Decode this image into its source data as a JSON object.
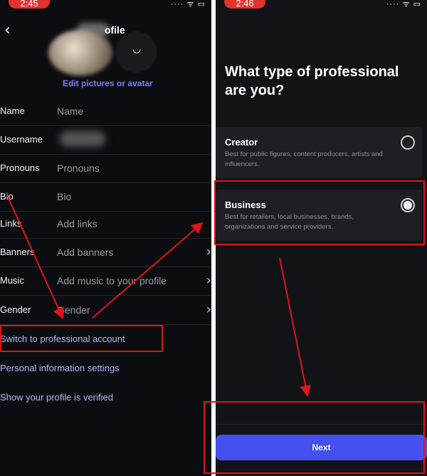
{
  "left_screen": {
    "status_time": "2:45",
    "status_icons": "···· ᯤ ▭",
    "back_icon": "chevron-left-icon",
    "title_partial": "ofile",
    "edit_link": "Edit pictures or avatar",
    "rows": [
      {
        "label": "Name",
        "value": "Name",
        "chevron": ""
      },
      {
        "label": "Username",
        "value": "",
        "chevron": ""
      },
      {
        "label": "Pronouns",
        "value": "Pronouns",
        "chevron": ""
      },
      {
        "label": "Bio",
        "value": "Bio",
        "chevron": ""
      },
      {
        "label": "Links",
        "value": "Add links",
        "chevron": ""
      },
      {
        "label": "Banners",
        "value": "Add banners",
        "chevron": "›"
      },
      {
        "label": "Music",
        "value": "Add music to your profile",
        "chevron": "›"
      },
      {
        "label": "Gender",
        "value": "Gender",
        "chevron": "›"
      }
    ],
    "links": {
      "switch_professional": "Switch to professional account",
      "personal_info": "Personal information settings",
      "verified": "Show your profile is verified"
    }
  },
  "right_screen": {
    "status_time": "2:46",
    "status_icons": "···· ᯤ ▭",
    "question": "What type of professional are you?",
    "options": [
      {
        "title": "Creator",
        "description": "Best for public figures, content producers, artists and influencers.",
        "selected": false
      },
      {
        "title": "Business",
        "description": "Best for retailers, local businesses, brands, organizations and service providers.",
        "selected": true
      }
    ],
    "next_button": "Next"
  },
  "annotation_color": "#e0141a",
  "accent_color": "#4550f0"
}
